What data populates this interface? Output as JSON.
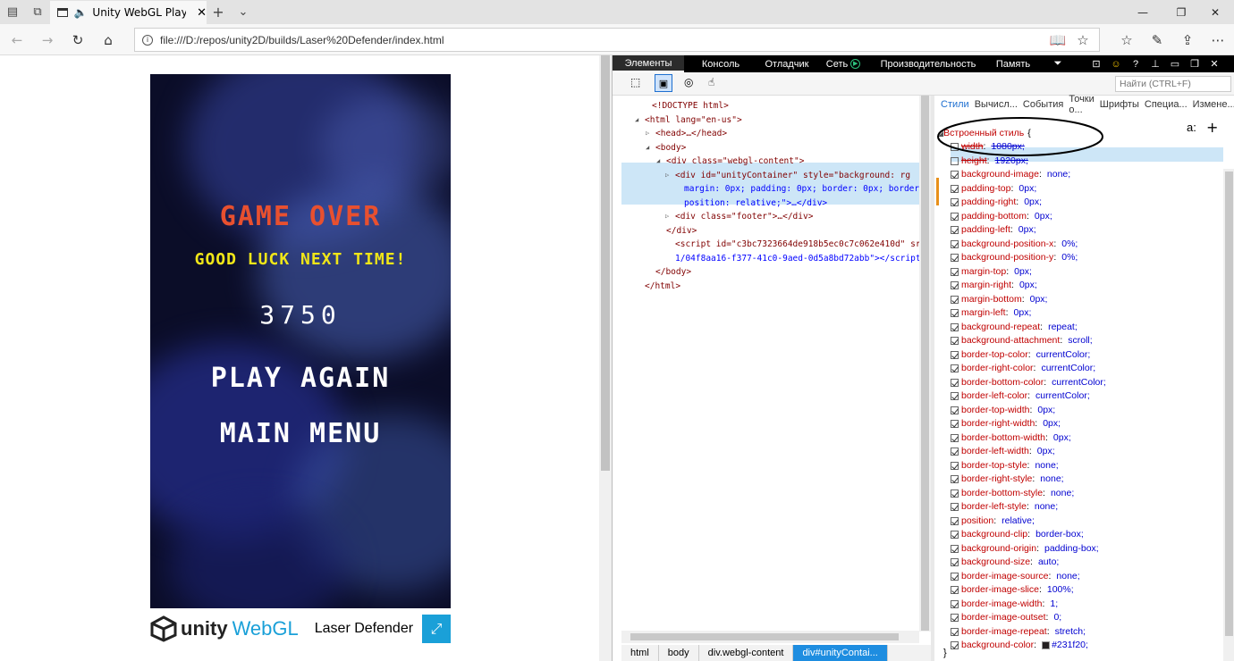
{
  "browser": {
    "tab_title": "Unity WebGL Player | Laser Defender",
    "tab_title_shown": "Unity WebGL Playe",
    "url": "file:///D:/repos/unity2D/builds/Laser%20Defender/index.html"
  },
  "game": {
    "title": "GAME OVER",
    "subtitle": "GOOD LUCK NEXT TIME!",
    "score": "3750",
    "play_again": "PLAY AGAIN",
    "main_menu": "MAIN MENU",
    "footer_unity": "unity",
    "footer_webgl": "WebGL",
    "footer_name": "Laser Defender",
    "colors": {
      "title": "#e8502f",
      "subtitle": "#f0e618",
      "text": "#ffffff",
      "bg": "#0b0d28",
      "fullscreen": "#1aa0d8"
    }
  },
  "devtools": {
    "tabs": [
      "Элементы",
      "Консоль",
      "Отладчик",
      "Сеть",
      "Производительность",
      "Память"
    ],
    "search_placeholder": "Найти (CTRL+F)",
    "dom": [
      "<!DOCTYPE html>",
      "<html lang=\"en-us\">",
      "<head>…</head>",
      "<body>",
      "<div class=\"webgl-content\">",
      "<div id=\"unityContainer\" style=\"background: rg",
      "margin: 0px; padding: 0px; border: 0px; border",
      "position: relative;\">…</div>",
      "<div class=\"footer\">…</div>",
      "</div>",
      "<script id=\"c3bc7323664de918b5ec0c7c062e410d\" sr",
      "1/04f8aa16-f377-41c0-9aed-0d5a8bd72abb\"></script",
      "</body>",
      "</html>"
    ],
    "breadcrumbs": [
      "html",
      "body",
      "div.webgl-content",
      "div#unityContai..."
    ],
    "style_tabs": [
      "Стили",
      "Вычисл...",
      "События",
      "Точки о...",
      "Шрифты",
      "Специа...",
      "Измене..."
    ],
    "inline_style_label": "Встроенный стиль",
    "brace_open": "{",
    "brace_close": "}",
    "rules": [
      {
        "p": "width",
        "v": "1080px;",
        "on": false
      },
      {
        "p": "height",
        "v": "1920px;",
        "on": false
      },
      {
        "p": "background-image",
        "v": "none;",
        "on": true
      },
      {
        "p": "padding-top",
        "v": "0px;",
        "on": true
      },
      {
        "p": "padding-right",
        "v": "0px;",
        "on": true
      },
      {
        "p": "padding-bottom",
        "v": "0px;",
        "on": true
      },
      {
        "p": "padding-left",
        "v": "0px;",
        "on": true
      },
      {
        "p": "background-position-x",
        "v": "0%;",
        "on": true
      },
      {
        "p": "background-position-y",
        "v": "0%;",
        "on": true
      },
      {
        "p": "margin-top",
        "v": "0px;",
        "on": true
      },
      {
        "p": "margin-right",
        "v": "0px;",
        "on": true
      },
      {
        "p": "margin-bottom",
        "v": "0px;",
        "on": true
      },
      {
        "p": "margin-left",
        "v": "0px;",
        "on": true
      },
      {
        "p": "background-repeat",
        "v": "repeat;",
        "on": true
      },
      {
        "p": "background-attachment",
        "v": "scroll;",
        "on": true
      },
      {
        "p": "border-top-color",
        "v": "currentColor;",
        "on": true
      },
      {
        "p": "border-right-color",
        "v": "currentColor;",
        "on": true
      },
      {
        "p": "border-bottom-color",
        "v": "currentColor;",
        "on": true
      },
      {
        "p": "border-left-color",
        "v": "currentColor;",
        "on": true
      },
      {
        "p": "border-top-width",
        "v": "0px;",
        "on": true
      },
      {
        "p": "border-right-width",
        "v": "0px;",
        "on": true
      },
      {
        "p": "border-bottom-width",
        "v": "0px;",
        "on": true
      },
      {
        "p": "border-left-width",
        "v": "0px;",
        "on": true
      },
      {
        "p": "border-top-style",
        "v": "none;",
        "on": true
      },
      {
        "p": "border-right-style",
        "v": "none;",
        "on": true
      },
      {
        "p": "border-bottom-style",
        "v": "none;",
        "on": true
      },
      {
        "p": "border-left-style",
        "v": "none;",
        "on": true
      },
      {
        "p": "position",
        "v": "relative;",
        "on": true
      },
      {
        "p": "background-clip",
        "v": "border-box;",
        "on": true
      },
      {
        "p": "background-origin",
        "v": "padding-box;",
        "on": true
      },
      {
        "p": "background-size",
        "v": "auto;",
        "on": true
      },
      {
        "p": "border-image-source",
        "v": "none;",
        "on": true
      },
      {
        "p": "border-image-slice",
        "v": "100%;",
        "on": true
      },
      {
        "p": "border-image-width",
        "v": "1;",
        "on": true
      },
      {
        "p": "border-image-outset",
        "v": "0;",
        "on": true
      },
      {
        "p": "border-image-repeat",
        "v": "stretch;",
        "on": true
      },
      {
        "p": "background-color",
        "v": "#231f20;",
        "on": true,
        "swatch": "#231f20"
      }
    ]
  }
}
